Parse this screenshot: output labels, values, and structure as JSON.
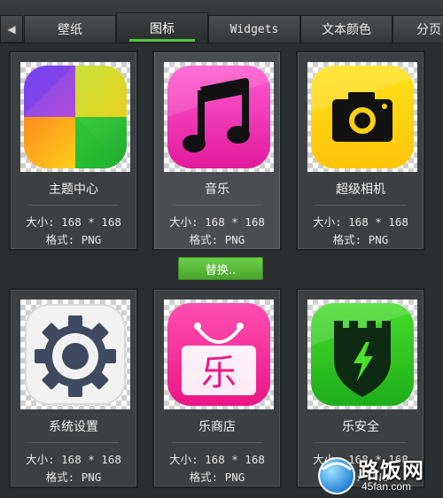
{
  "tabs": [
    {
      "label": "壁纸",
      "active": false
    },
    {
      "label": "图标",
      "active": true
    },
    {
      "label": "Widgets",
      "active": false
    },
    {
      "label": "文本颜色",
      "active": false
    },
    {
      "label": "分页",
      "active": false
    }
  ],
  "tab_scroll_left_icon": "triangle-left",
  "accent_color": "#4cc43a",
  "cards": [
    {
      "name": "主题中心",
      "size": "大小: 168 * 168",
      "format": "格式: PNG",
      "icon": "theme-center-icon",
      "selected": false
    },
    {
      "name": "音乐",
      "size": "大小: 168 * 168",
      "format": "格式: PNG",
      "icon": "music-icon",
      "selected": true
    },
    {
      "name": "超级相机",
      "size": "大小: 168 * 168",
      "format": "格式: PNG",
      "icon": "camera-icon",
      "selected": false
    },
    {
      "name": "系统设置",
      "size": "大小: 168 * 168",
      "format": "格式: PNG",
      "icon": "settings-gear-icon",
      "selected": false
    },
    {
      "name": "乐商店",
      "size": "大小: 168 * 168",
      "format": "格式: PNG",
      "icon": "store-icon",
      "selected": false
    },
    {
      "name": "乐安全",
      "size": "大小: 168 * 168",
      "format": "格式: PNG",
      "icon": "security-shield-icon",
      "selected": false
    }
  ],
  "replace_button": "替换..",
  "watermark": {
    "title": "路饭网",
    "url": "45fan.com"
  }
}
